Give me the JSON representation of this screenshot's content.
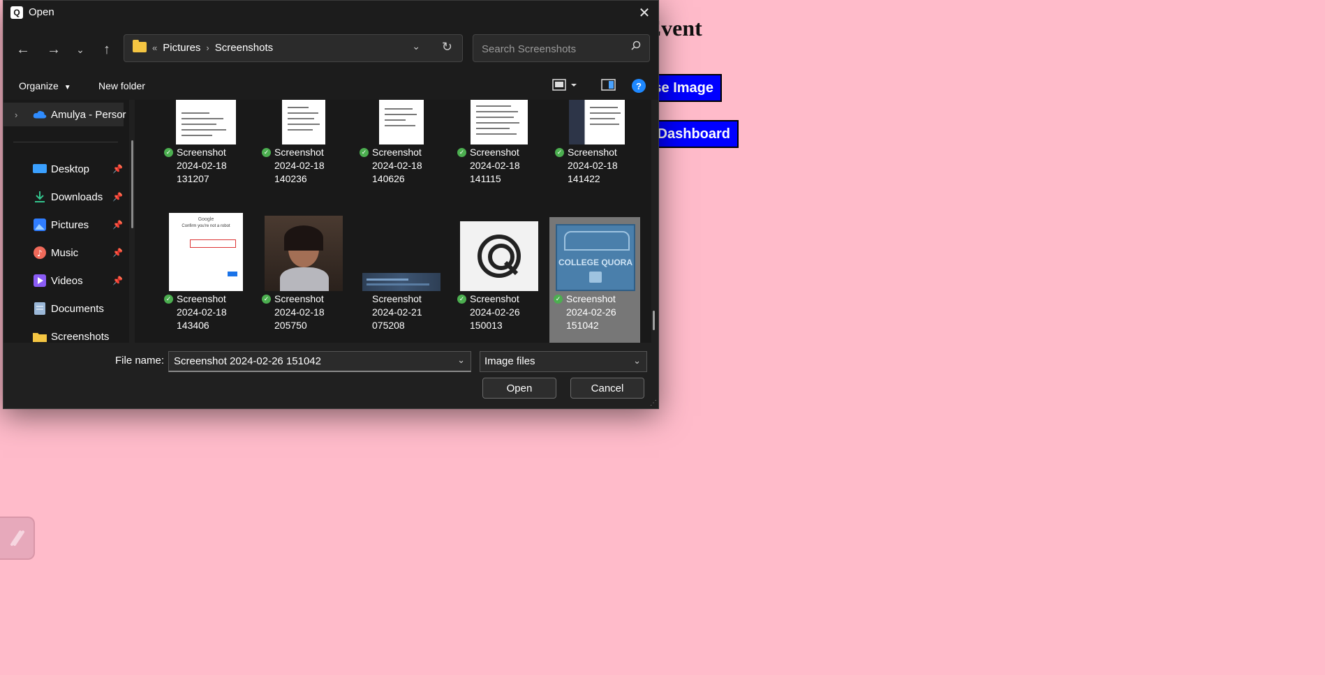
{
  "background_page": {
    "heading": "n Event",
    "choose_button": "se Image",
    "dashboard_button": "Dashboard"
  },
  "dialog": {
    "title": "Open",
    "breadcrumb": {
      "overflow": "«",
      "items": [
        "Pictures",
        "Screenshots"
      ],
      "separator": "›"
    },
    "search_placeholder": "Search Screenshots",
    "toolbar": {
      "organize": "Organize",
      "new_folder": "New folder",
      "help": "?"
    },
    "nav_pane": {
      "cloud_item": "Amulya - Persor",
      "items": [
        {
          "label": "Desktop",
          "icon": "desktop-icon",
          "pinned": true
        },
        {
          "label": "Downloads",
          "icon": "downloads-icon",
          "pinned": true
        },
        {
          "label": "Pictures",
          "icon": "pictures-icon",
          "pinned": true
        },
        {
          "label": "Music",
          "icon": "music-icon",
          "pinned": true
        },
        {
          "label": "Videos",
          "icon": "videos-icon",
          "pinned": true
        },
        {
          "label": "Documents",
          "icon": "documents-icon",
          "pinned": false
        },
        {
          "label": "Screenshots",
          "icon": "folder-icon",
          "pinned": false
        }
      ]
    },
    "files": [
      {
        "line1": "Screenshot",
        "line2": "2024-02-18",
        "line3": "131207",
        "thumb": "document",
        "synced": true
      },
      {
        "line1": "Screenshot",
        "line2": "2024-02-18",
        "line3": "140236",
        "thumb": "document",
        "synced": true
      },
      {
        "line1": "Screenshot",
        "line2": "2024-02-18",
        "line3": "140626",
        "thumb": "document",
        "synced": true
      },
      {
        "line1": "Screenshot",
        "line2": "2024-02-18",
        "line3": "141115",
        "thumb": "document",
        "synced": true
      },
      {
        "line1": "Screenshot",
        "line2": "2024-02-18",
        "line3": "141422",
        "thumb": "document-dark-sidebar",
        "synced": true
      },
      {
        "line1": "Screenshot",
        "line2": "2024-02-18",
        "line3": "143406",
        "thumb": "google-signin-form",
        "synced": true
      },
      {
        "line1": "Screenshot",
        "line2": "2024-02-18",
        "line3": "205750",
        "thumb": "photo-portrait",
        "synced": true
      },
      {
        "line1": "Screenshot",
        "line2": "2024-02-21",
        "line3": "075208",
        "thumb": "dark-strip",
        "synced": false
      },
      {
        "line1": "Screenshot",
        "line2": "2024-02-26",
        "line3": "150013",
        "thumb": "cq-logo",
        "synced": true
      },
      {
        "line1": "Screenshot",
        "line2": "2024-02-26",
        "line3": "151042",
        "thumb": "college-quora-banner",
        "synced": true,
        "selected": true
      }
    ],
    "thumb_texts": {
      "google_title": "Google",
      "google_subtitle": "Confirm you're not a robot",
      "banner_text": "COLLEGE QUORA"
    },
    "file_name_label": "File name:",
    "file_name_value": "Screenshot 2024-02-26 151042",
    "file_type": "Image files",
    "open_button": "Open",
    "cancel_button": "Cancel"
  },
  "colors": {
    "page_background": "#ffbbca",
    "button_blue": "#0000ff",
    "dialog_background": "#202020",
    "selection": "#777777",
    "sync_green": "#4caf50"
  }
}
